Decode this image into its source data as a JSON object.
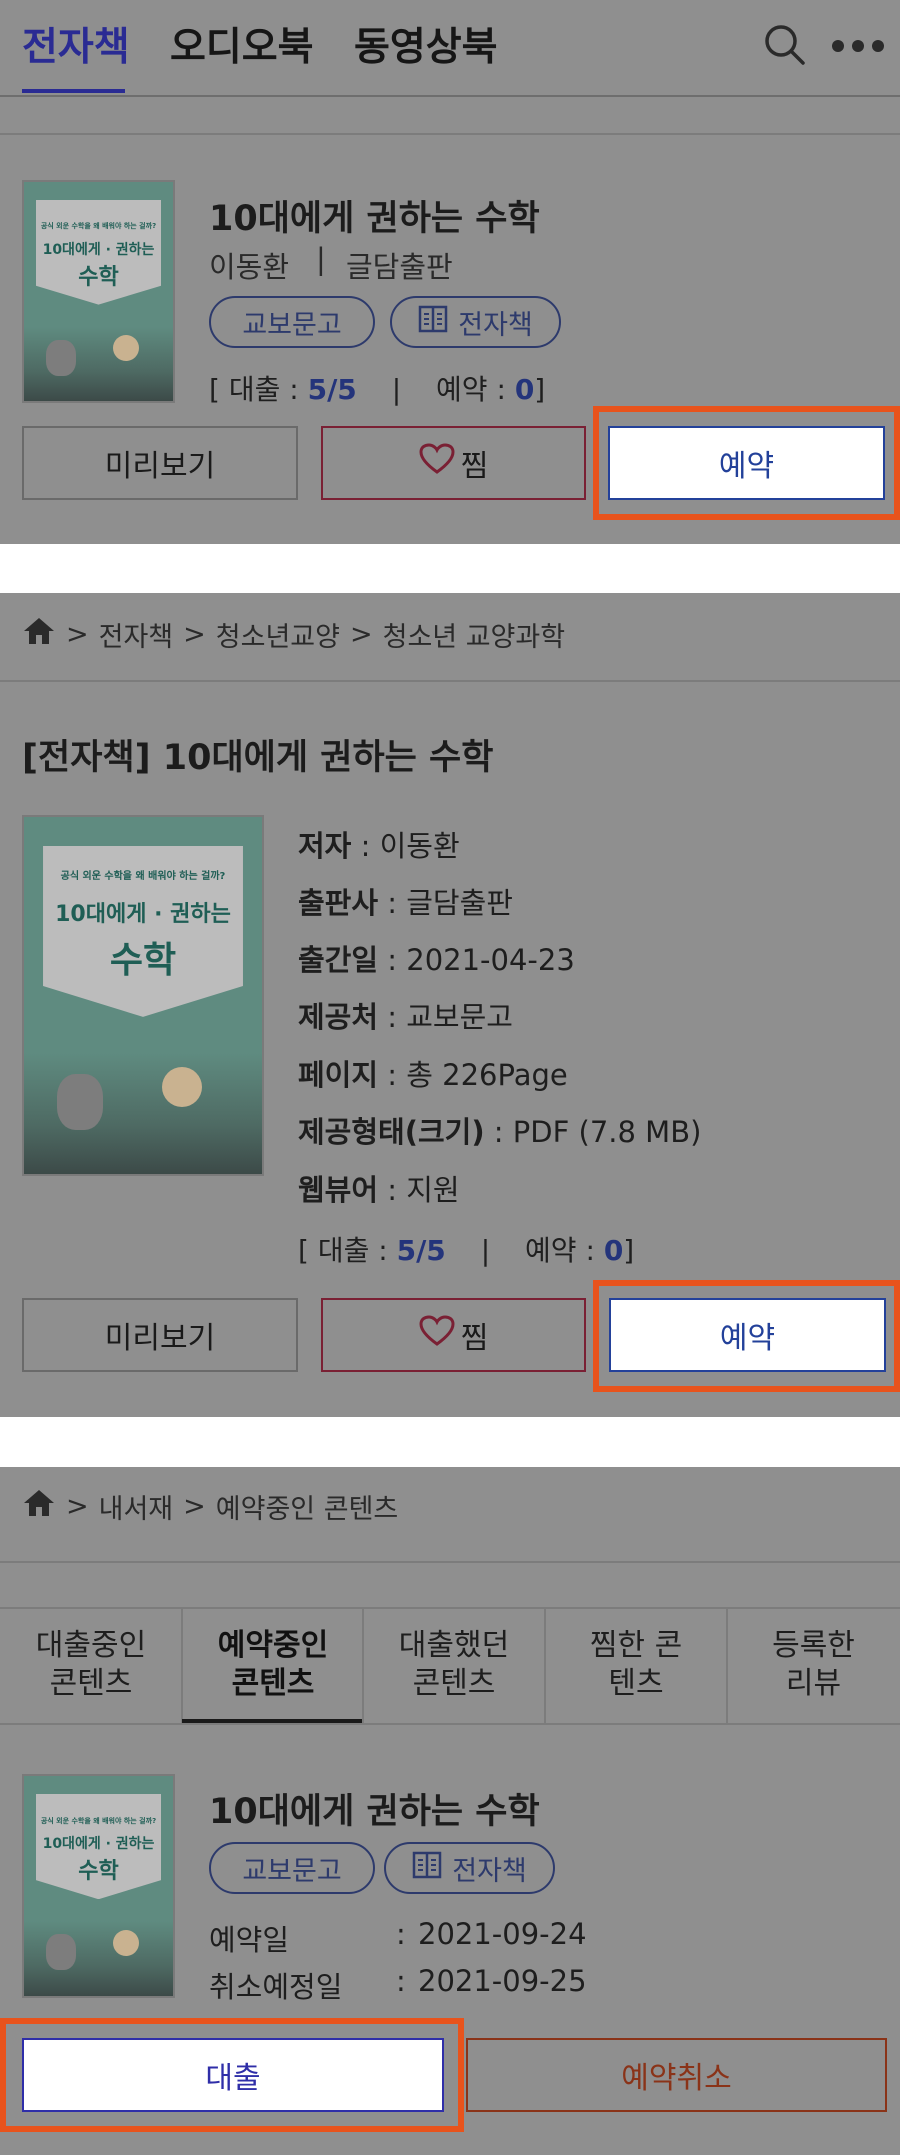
{
  "top_tabs": [
    "전자책",
    "오디오북",
    "동영상북"
  ],
  "book": {
    "title": "10대에게 권하는 수학",
    "author": "이동환",
    "publisher": "글담출판",
    "provider_badge": "교보문고",
    "format_badge": "전자책",
    "cover_lines": [
      "공식 외운 수학을 왜 배워야 하는 걸까?",
      "10대에게 · 권하는",
      "수학"
    ],
    "loan_label": "[ 대출 :",
    "loan_value": "5/5",
    "reserve_label": "예약 :",
    "reserve_value": "0",
    "close_bracket": "]"
  },
  "buttons": {
    "preview": "미리보기",
    "wish": "찜",
    "reserve": "예약",
    "loan": "대출",
    "cancel_reserve": "예약취소"
  },
  "detail": {
    "breadcrumb": [
      "전자책",
      "청소년교양",
      "청소년 교양과학"
    ],
    "page_title": "[전자책] 10대에게 권하는 수학",
    "rows": [
      {
        "key": "저자",
        "value": " : 이동환"
      },
      {
        "key": "출판사",
        "value": " : 글담출판"
      },
      {
        "key": "출간일",
        "value": " : 2021-04-23"
      },
      {
        "key": "제공처",
        "value": " : 교보문고"
      },
      {
        "key": "페이지",
        "value": " : 총 226Page"
      },
      {
        "key": "제공형태(크기)",
        "value": " : PDF (7.8 MB)"
      },
      {
        "key": "웹뷰어",
        "value": " : 지원"
      }
    ]
  },
  "library": {
    "breadcrumb": [
      "내서재",
      "예약중인 콘텐츠"
    ],
    "tabs": [
      "대출중인 콘텐츠",
      "예약중인 콘텐츠",
      "대출했던 콘텐츠",
      "찜한 콘텐츠",
      "등록한 리뷰"
    ],
    "active_tab": 1,
    "reserve_date_label": "예약일",
    "reserve_date": "2021-09-24",
    "cancel_date_label": "취소예정일",
    "cancel_date": "2021-09-25",
    "colon": ":"
  },
  "colors": {
    "accent": "#2a2b93",
    "highlight": "#e8531c",
    "overlay_gray": "#8f8f8f"
  }
}
